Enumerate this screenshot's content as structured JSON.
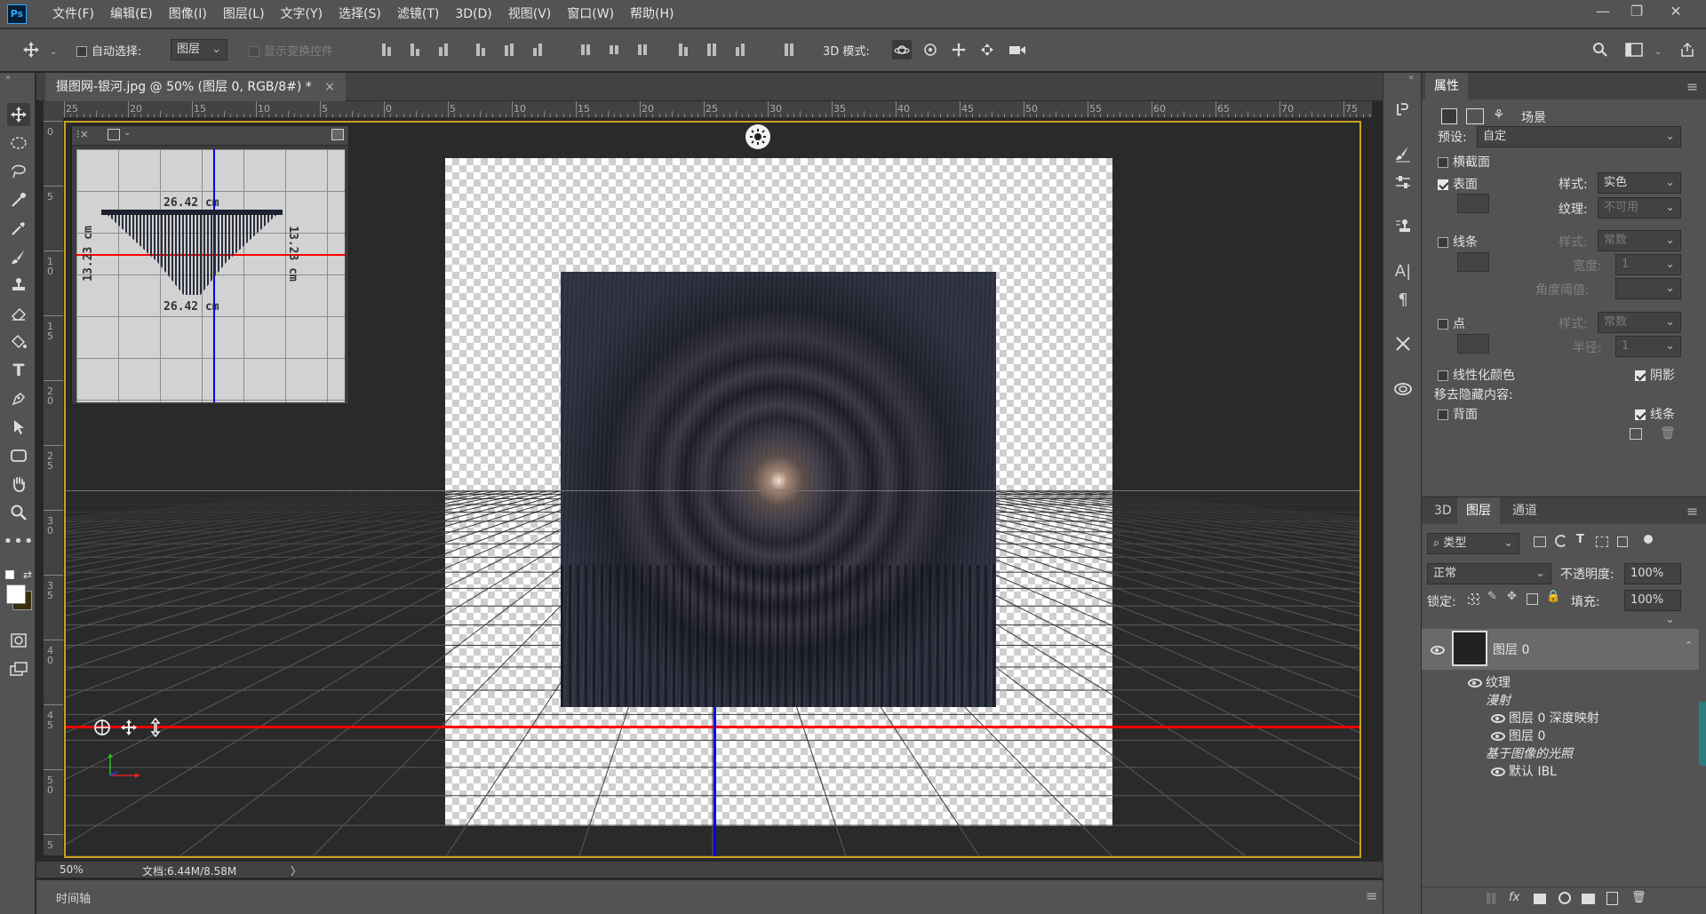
{
  "app": {
    "logo": "Ps"
  },
  "menu": [
    "文件(F)",
    "编辑(E)",
    "图像(I)",
    "图层(L)",
    "文字(Y)",
    "选择(S)",
    "滤镜(T)",
    "3D(D)",
    "视图(V)",
    "窗口(W)",
    "帮助(H)"
  ],
  "window_controls": {
    "minimize": "—",
    "restore": "❐",
    "close": "✕"
  },
  "options": {
    "auto_select_label": "自动选择:",
    "auto_select_value": "图层",
    "show_transform_label": "显示变换控件",
    "mode_3d_label": "3D 模式:"
  },
  "document": {
    "tab_title": "摄图网-银河.jpg @ 50% (图层 0, RGB/8#) *",
    "tab_close": "×",
    "zoom": "50%",
    "doc_size": "文档:6.44M/8.58M",
    "status_arrow": "〉"
  },
  "ruler_h": [
    "25",
    "20",
    "15",
    "10",
    "5",
    "0",
    "5",
    "10",
    "15",
    "20",
    "25",
    "30",
    "35",
    "40",
    "45",
    "50",
    "55",
    "60",
    "65",
    "70",
    "75"
  ],
  "ruler_v": [
    "0",
    "5",
    "1\n0",
    "1\n5",
    "2\n0",
    "2\n5",
    "3\n0",
    "3\n5",
    "4\n0",
    "4\n5",
    "5\n0",
    "5"
  ],
  "navigator": {
    "width_top": "26.42 cm",
    "width_bottom": "26.42 cm",
    "height_left": "13.23 cm",
    "height_right": "13.23 cm"
  },
  "properties": {
    "tab": "属性",
    "sub_tab": "场景",
    "preset_label": "预设:",
    "preset_value": "自定",
    "cross_section": "横截面",
    "surface": "表面",
    "surface_style_label": "样式:",
    "surface_style_value": "实色",
    "texture_label": "纹理:",
    "texture_value": "不可用",
    "lines": "线条",
    "lines_style_label": "样式:",
    "lines_style_value": "常数",
    "width_label": "宽度:",
    "width_value": "1",
    "angle_label": "角度阈值:",
    "points": "点",
    "points_style_label": "样式:",
    "points_style_value": "常数",
    "radius_label": "半径:",
    "radius_value": "1",
    "linearize": "线性化颜色",
    "shadow": "阴影",
    "remove_hidden": "移去隐藏内容:",
    "backface": "背面",
    "lines2": "线条"
  },
  "layers_panel": {
    "tabs": [
      "3D",
      "图层",
      "通道"
    ],
    "filter_label": "类型",
    "blend_mode": "正常",
    "opacity_label": "不透明度:",
    "opacity_value": "100%",
    "lock_label": "锁定:",
    "fill_label": "填充:",
    "fill_value": "100%",
    "layer_name": "图层 0",
    "texture_group": "纹理",
    "diffuse": "漫射",
    "depth_map": "图层 0 深度映射",
    "layer0_tex": "图层 0",
    "ibl_group": "基于图像的光照",
    "default_ibl": "默认 IBL"
  },
  "timeline": {
    "label": "时间轴"
  },
  "colors": {
    "accent_gold": "#c8a21f",
    "axis_red": "#ff0000",
    "axis_blue": "#0000ff",
    "ps_blue": "#31a8ff"
  }
}
